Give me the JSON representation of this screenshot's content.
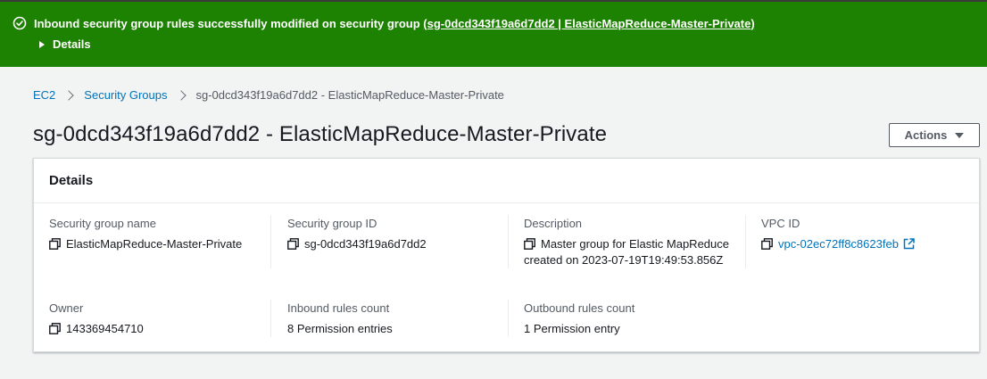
{
  "banner": {
    "message": "Inbound security group rules successfully modified on security group ",
    "link": "(sg-0dcd343f19a6d7dd2 | ElasticMapReduce-Master-Private)",
    "details_label": "Details"
  },
  "breadcrumb": {
    "items": [
      "EC2",
      "Security Groups"
    ],
    "current": "sg-0dcd343f19a6d7dd2 - ElasticMapReduce-Master-Private"
  },
  "page": {
    "title": "sg-0dcd343f19a6d7dd2 - ElasticMapReduce-Master-Private",
    "actions_label": "Actions"
  },
  "details": {
    "title": "Details",
    "security_group_name": {
      "label": "Security group name",
      "value": "ElasticMapReduce-Master-Private"
    },
    "security_group_id": {
      "label": "Security group ID",
      "value": "sg-0dcd343f19a6d7dd2"
    },
    "description": {
      "label": "Description",
      "value_line1": "Master group for Elastic MapReduce",
      "value_line2": "created on 2023-07-19T19:49:53.856Z"
    },
    "vpc_id": {
      "label": "VPC ID",
      "value": "vpc-02ec72ff8c8623feb"
    },
    "owner": {
      "label": "Owner",
      "value": "143369454710"
    },
    "inbound_rules_count": {
      "label": "Inbound rules count",
      "value": "8 Permission entries"
    },
    "outbound_rules_count": {
      "label": "Outbound rules count",
      "value": "1 Permission entry"
    }
  },
  "colors": {
    "success_green": "#1d8102",
    "link_blue": "#0073bb",
    "page_bg": "#f2f3f3"
  }
}
